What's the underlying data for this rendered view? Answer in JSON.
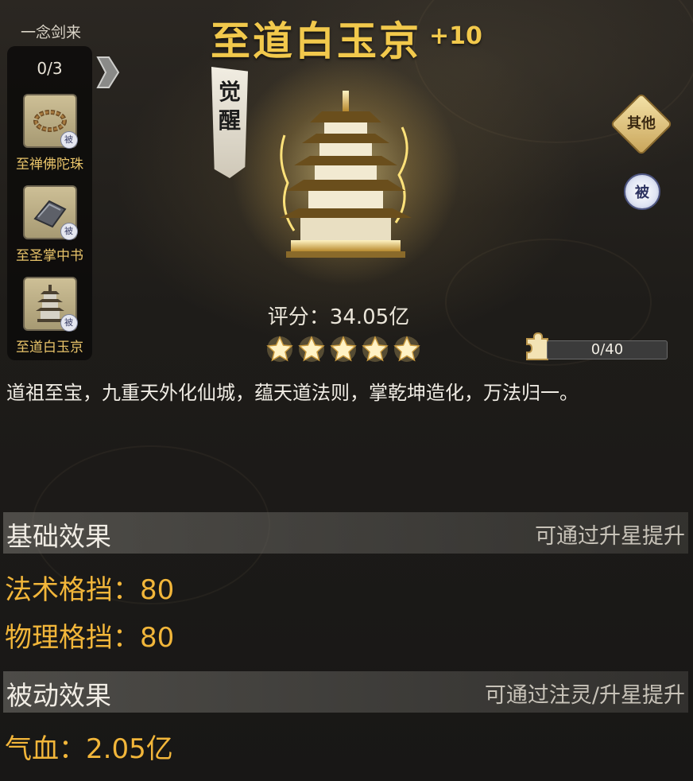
{
  "series": {
    "title": "一念剑来",
    "count": "0/3",
    "items": [
      {
        "name": "至禅佛陀珠",
        "badge": "被",
        "icon": "prayer-beads-icon"
      },
      {
        "name": "至圣掌中书",
        "badge": "被",
        "icon": "scroll-book-icon"
      },
      {
        "name": "至道白玉京",
        "badge": "被",
        "icon": "pagoda-icon"
      }
    ]
  },
  "item": {
    "name": "至道白玉京",
    "level": "+10",
    "awaken_chars": [
      "觉",
      "醒"
    ],
    "score_label": "评分：",
    "score_value": "34.05亿",
    "stars": 5
  },
  "side_buttons": {
    "other": "其他",
    "passive": "被"
  },
  "fragments": {
    "text": "0/40",
    "progress": 0
  },
  "description": "道祖至宝，九重天外化仙城，蕴天道法则，掌乾坤造化，万法归一。",
  "base_effect": {
    "title": "基础效果",
    "hint": "可通过升星提升",
    "stats": [
      "法术格挡：80",
      "物理格挡：80"
    ]
  },
  "passive_effect": {
    "title": "被动效果",
    "hint": "可通过注灵/升星提升",
    "stats": [
      "气血：2.05亿"
    ]
  },
  "colors": {
    "title_gold": "#f2c94c",
    "stat_orange": "#f2b63a",
    "slot_name": "#e9c46a"
  }
}
